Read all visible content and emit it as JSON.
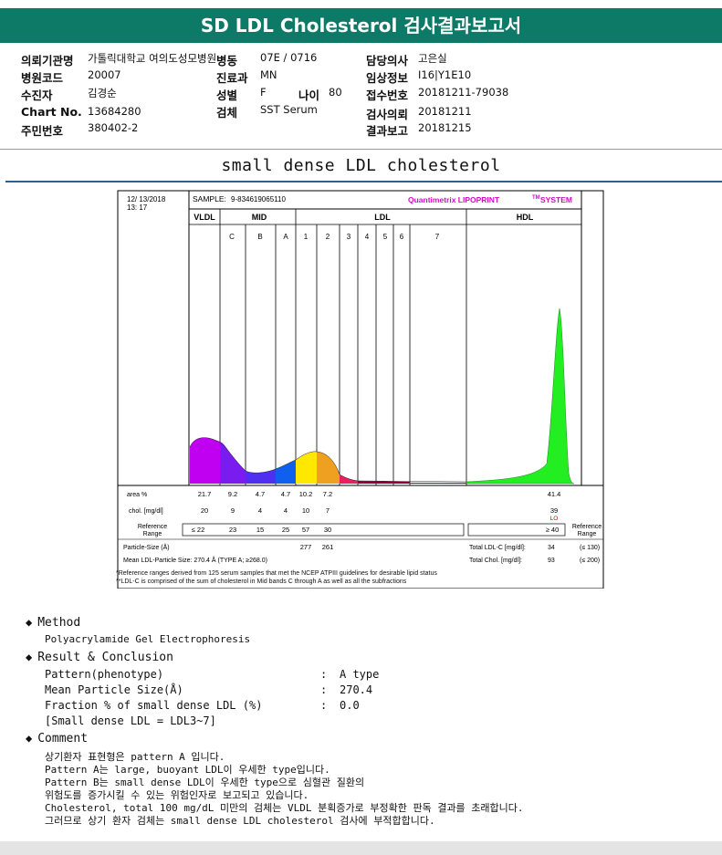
{
  "title": "SD LDL Cholesterol 검사결과보고서",
  "info": {
    "request_org_label": "의뢰기관명",
    "request_org": "가톨릭대학교 여의도성모병원",
    "ward_label": "병동",
    "ward": "07E / 0716",
    "doctor_label": "담당의사",
    "doctor": "고은실",
    "hosp_code_label": "병원코드",
    "hosp_code": "20007",
    "dept_label": "진료과",
    "dept": "MN",
    "clinical_label": "임상정보",
    "clinical": "I16|Y1E10",
    "patient_label": "수진자",
    "patient": "김경순",
    "sex_label": "성별",
    "sex": "F",
    "age_label": "나이",
    "age": "80",
    "receipt_label": "접수번호",
    "receipt": "20181211-79038",
    "chart_label": "Chart No.",
    "chart": "13684280",
    "specimen_label": "검체",
    "specimen": "SST Serum",
    "req_date_label": "검사의뢰",
    "req_date": "20181211",
    "id_label": "주민번호",
    "id": "380402-2",
    "report_date_label": "결과보고",
    "report_date": "20181215"
  },
  "subtitle": "small dense LDL cholesterol",
  "report": {
    "date": "12/ 13/2018",
    "time": "13: 17",
    "sample_label": "SAMPLE:",
    "sample": "9-834619065110",
    "system_name": "Quantimetrix LIPOPRINT",
    "system_tm": "TM",
    "system_suffix": "SYSTEM",
    "groups": [
      "VLDL",
      "MID",
      "LDL",
      "HDL"
    ],
    "bands": [
      "C",
      "B",
      "A",
      "1",
      "2",
      "3",
      "4",
      "5",
      "6",
      "7"
    ],
    "area_label": "area %",
    "area": [
      "21.7",
      "9.2",
      "4.7",
      "4.7",
      "10.2",
      "7.2",
      "41.4"
    ],
    "chol_label": "chol. [mg/dl]",
    "chol": [
      "20",
      "9",
      "4",
      "4",
      "10",
      "7",
      "39"
    ],
    "lo": "LO",
    "ref_label_1": "Reference",
    "ref_label_2": "Range",
    "ref": [
      "≤ 22",
      "23",
      "15",
      "25",
      "57",
      "30"
    ],
    "ref_hdl": "≥ 40",
    "particle_label": "Particle-Size (Å)",
    "particle": [
      "277",
      "261"
    ],
    "mean_particle": "Mean LDL-Particle Size:  270.4 Å  (TYPE A; ≥268.0)",
    "total_ldl_label": "Total LDL-C [mg/dl]:",
    "total_ldl": "34",
    "total_ldl_ref": "(≤ 130)",
    "total_chol_label": "Total Chol. [mg/dl]:",
    "total_chol": "93",
    "total_chol_ref": "(≤ 200)",
    "footnote1": "*Reference ranges derived from 125 serum samples that met the NCEP ATPIII guidelines for desirable lipid status",
    "footnote2": "**LDL-C is comprised of the sum of cholesterol in Mid bands C through A as well as all the subfractions"
  },
  "method": {
    "heading": "Method",
    "text": "Polyacrylamide Gel Electrophoresis"
  },
  "result": {
    "heading": "Result & Conclusion",
    "rows": [
      {
        "label": "Pattern(phenotype)",
        "value": "A type"
      },
      {
        "label": "Mean Particle Size(Å)",
        "value": "270.4"
      },
      {
        "label": "Fraction % of small dense LDL (%)",
        "value": "0.0"
      }
    ],
    "sep": ":",
    "note": "[Small dense LDL = LDL3~7]"
  },
  "comment": {
    "heading": "Comment",
    "lines": [
      "상기환자 표현형은 pattern A 입니다.",
      "Pattern A는 large, buoyant LDL이 우세한 type입니다.",
      "Pattern B는 small dense LDL이 우세한 type으로 심혈관 질환의",
      "위험도를 증가시킬 수 있는 위험인자로 보고되고 있습니다.",
      "Cholesterol, total 100 mg/dL 미만의 검체는 VLDL 분획증가로 부정확한 판독 결과를 초래합니다.",
      "그러므로 상기 환자 검체는 small dense LDL cholesterol 검사에 부적합합니다."
    ]
  },
  "colors": {
    "header": "#0d7a68",
    "vldl": "#c000f0",
    "midC": "#7a1cf0",
    "midB": "#5030f0",
    "midA": "#1060f0",
    "ldl1": "#ffe800",
    "ldl2": "#f0a020",
    "ldl3": "#e82060",
    "ldl_tail": "#90003a",
    "hdl": "#22ee22",
    "system": "#d010c0"
  }
}
